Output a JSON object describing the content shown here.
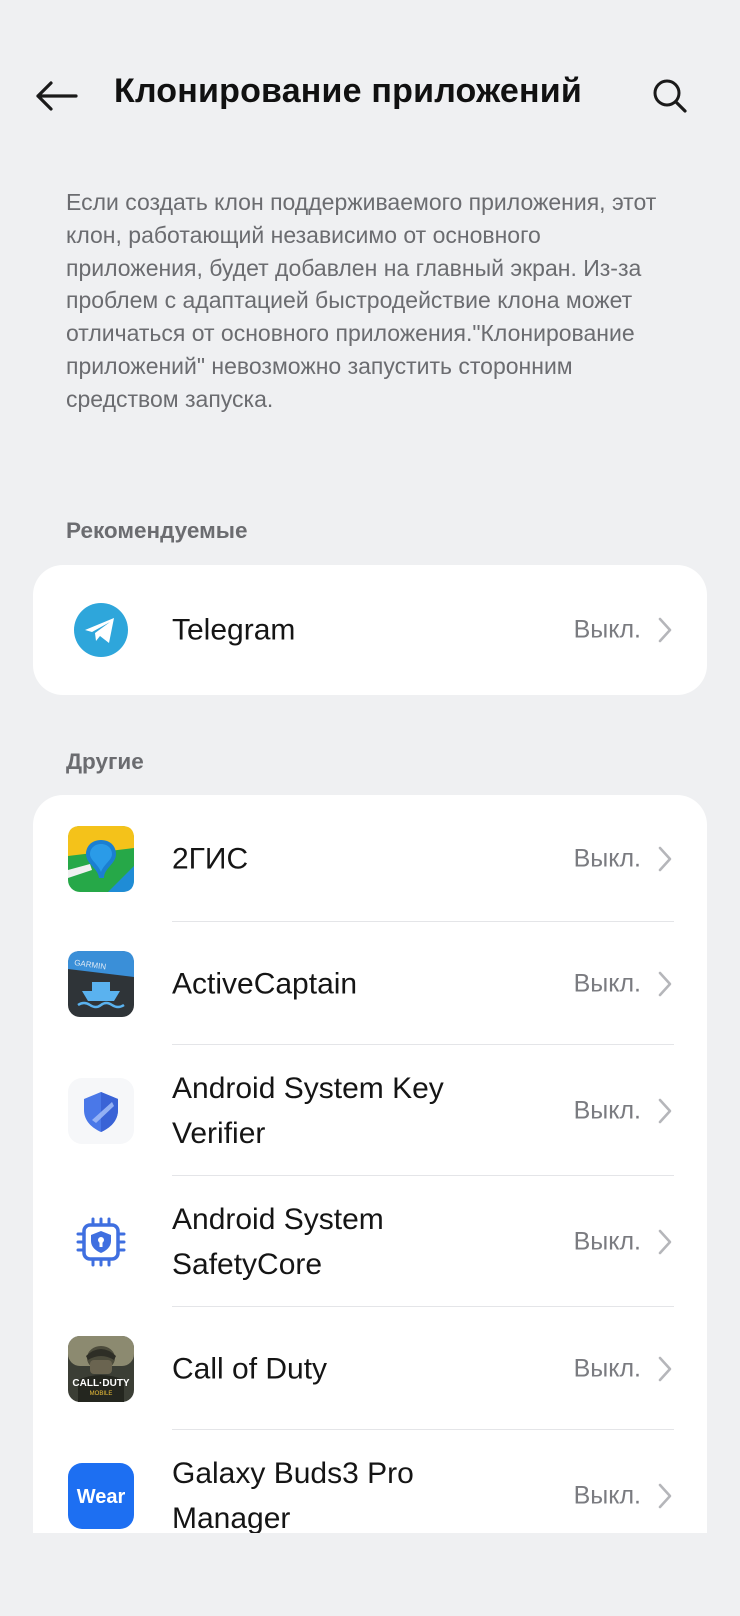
{
  "header": {
    "title": "Клонирование приложений"
  },
  "description": "Если создать клон поддерживаемого приложения, этот клон, работающий независимо от основного приложения, будет добавлен на главный экран. Из-за проблем с адаптацией быстродействие клона может отличаться от основного приложения.\"Клонирование приложений\" невозможно запустить сторонним средством запуска.",
  "sections": {
    "recommended_label": "Рекомендуемые",
    "others_label": "Другие"
  },
  "recommended": [
    {
      "name": "Telegram",
      "status": "Выкл.",
      "icon": "telegram-icon"
    }
  ],
  "others": [
    {
      "name": "2ГИС",
      "status": "Выкл.",
      "icon": "2gis-icon"
    },
    {
      "name": "ActiveCaptain",
      "status": "Выкл.",
      "icon": "activecaptain-icon",
      "icon_text": "GARMIN"
    },
    {
      "name": "Android System Key Verifier",
      "status": "Выкл.",
      "icon": "key-verifier-shield-icon"
    },
    {
      "name": "Android System SafetyCore",
      "status": "Выкл.",
      "icon": "safetycore-chip-icon"
    },
    {
      "name": "Call of Duty",
      "status": "Выкл.",
      "icon": "call-of-duty-icon",
      "icon_text": "CALL·DUTY",
      "icon_subtext": "MOBILE"
    },
    {
      "name": "Galaxy Buds3 Pro Manager",
      "status": "Выкл.",
      "icon": "galaxy-wear-icon",
      "icon_text": "Wear"
    }
  ],
  "colors": {
    "background": "#eff0f2",
    "card": "#ffffff",
    "secondary_text": "#6b6c70",
    "telegram_blue": "#2ea6db",
    "wear_blue": "#1d6ff2"
  }
}
